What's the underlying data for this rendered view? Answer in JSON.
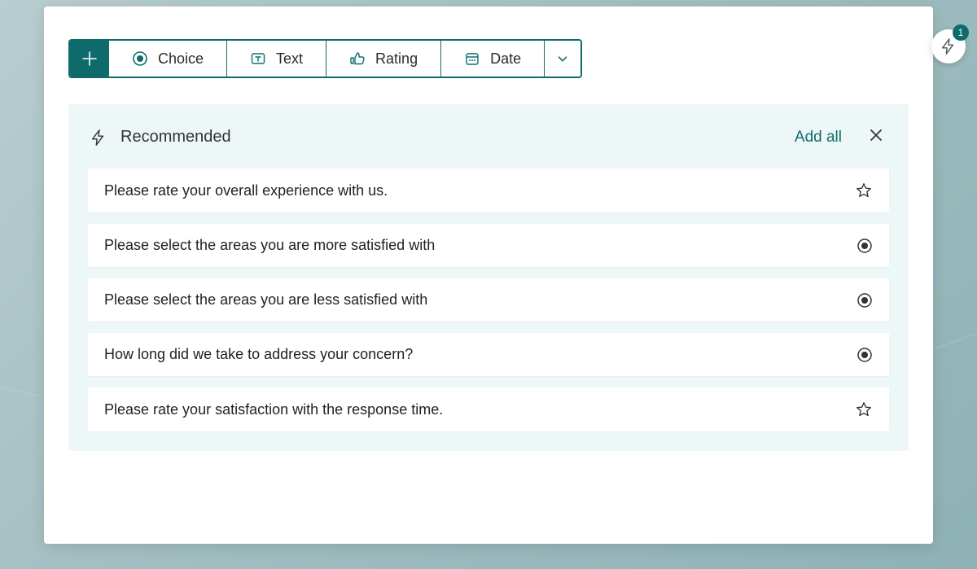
{
  "toolbar": {
    "choice_label": "Choice",
    "text_label": "Text",
    "rating_label": "Rating",
    "date_label": "Date"
  },
  "recommended": {
    "title": "Recommended",
    "add_all_label": "Add all",
    "questions": [
      {
        "text": "Please rate your overall experience with us.",
        "type": "rating"
      },
      {
        "text": "Please select the areas you are more satisfied with",
        "type": "choice"
      },
      {
        "text": "Please select the areas you are less satisfied with",
        "type": "choice"
      },
      {
        "text": "How long did we take to address your concern?",
        "type": "choice"
      },
      {
        "text": "Please rate your satisfaction with the response time.",
        "type": "rating"
      }
    ]
  },
  "floating_badge_count": "1",
  "colors": {
    "accent": "#0f6b6b",
    "panel_bg": "#eef7f8"
  }
}
